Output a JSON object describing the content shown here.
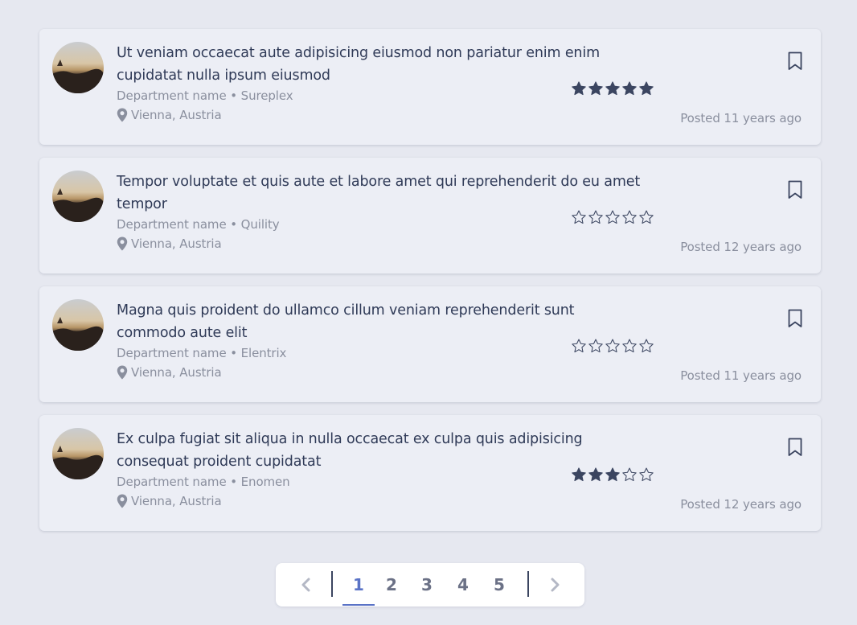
{
  "jobs": [
    {
      "title": "Ut veniam occaecat aute adipisicing eiusmod non pariatur enim enim cupidatat nulla ipsum eiusmod",
      "department": "Department name • Sureplex",
      "location": "Vienna, Austria",
      "rating": 5,
      "posted": "Posted 11 years ago"
    },
    {
      "title": "Tempor voluptate et quis aute et labore amet qui reprehenderit do eu amet tempor",
      "department": "Department name • Quility",
      "location": "Vienna, Austria",
      "rating": 0,
      "posted": "Posted 12 years ago"
    },
    {
      "title": "Magna quis proident do ullamco cillum veniam reprehenderit sunt commodo aute elit",
      "department": "Department name • Elentrix",
      "location": "Vienna, Austria",
      "rating": 0,
      "posted": "Posted 11 years ago"
    },
    {
      "title": "Ex culpa fugiat sit aliqua in nulla occaecat ex culpa quis adipisicing consequat proident cupidatat",
      "department": "Department name • Enomen",
      "location": "Vienna, Austria",
      "rating": 3,
      "posted": "Posted 12 years ago"
    }
  ],
  "rating_max": 5,
  "pagination": {
    "pages": [
      "1",
      "2",
      "3",
      "4",
      "5"
    ],
    "current": "1",
    "prev_icon": "chevron-left-icon",
    "next_icon": "chevron-right-icon"
  },
  "icons": {
    "location": "map-pin-icon",
    "bookmark": "bookmark-icon",
    "star": "star-icon"
  },
  "colors": {
    "background": "#e6e8f0",
    "card": "#eceef5",
    "title": "#2f3a57",
    "muted": "#8a8f9e",
    "star": "#3b4560",
    "accent": "#5a73c6"
  }
}
